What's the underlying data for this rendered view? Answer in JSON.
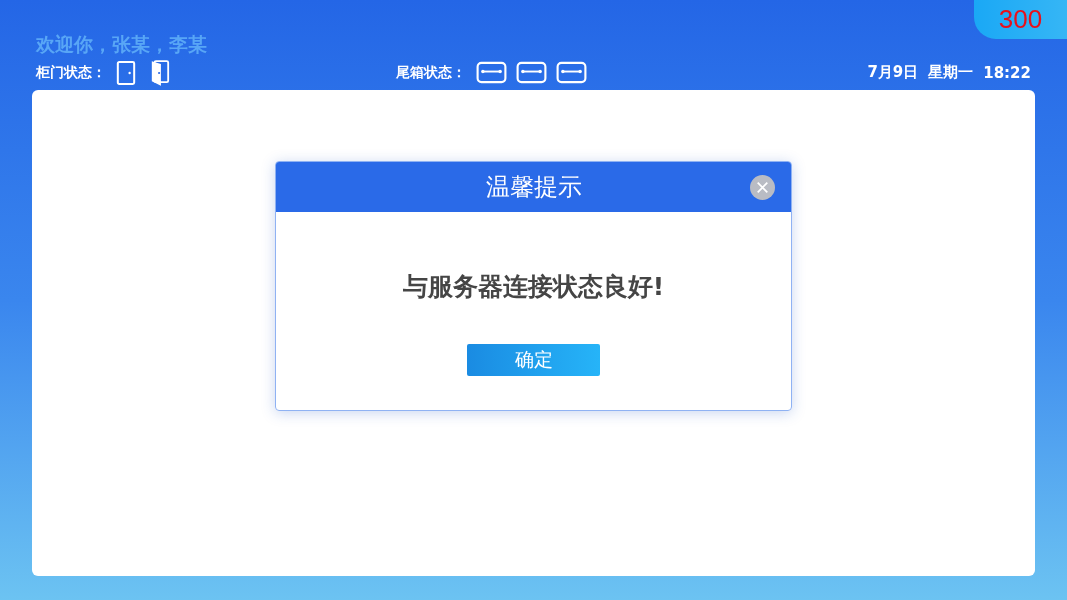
{
  "countdown": "300",
  "welcome": "欢迎你，张某，李某",
  "door_status": {
    "label": "柜门状态：",
    "doors": [
      {
        "kind": "closed"
      },
      {
        "kind": "open"
      }
    ]
  },
  "trunk_status": {
    "label": "尾箱状态：",
    "trunks": [
      {
        "kind": "closed"
      },
      {
        "kind": "closed"
      },
      {
        "kind": "closed"
      }
    ]
  },
  "datetime": {
    "date": "7月9日",
    "weekday": "星期一",
    "time": "18:22"
  },
  "dialog": {
    "title": "温馨提示",
    "message": "与服务器连接状态良好!",
    "confirm": "确定"
  }
}
